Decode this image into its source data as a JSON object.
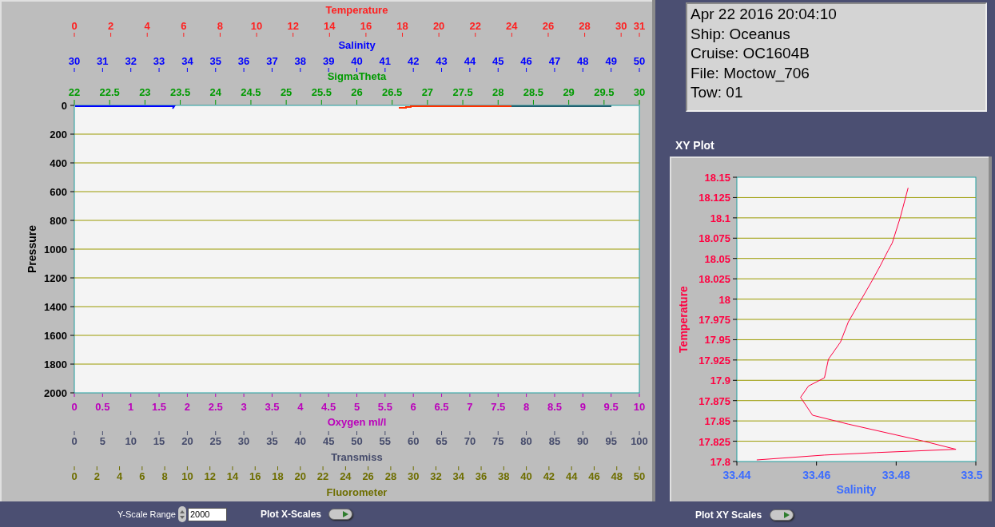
{
  "depth_plot": {
    "top_axes": [
      {
        "title": "Temperature",
        "color": "#ff2020",
        "ticks": [
          "0",
          "2",
          "4",
          "6",
          "8",
          "10",
          "12",
          "14",
          "16",
          "18",
          "20",
          "22",
          "24",
          "26",
          "28",
          "30",
          "31"
        ]
      },
      {
        "title": "Salinity",
        "color": "#0000ff",
        "ticks": [
          "30",
          "31",
          "32",
          "33",
          "34",
          "35",
          "36",
          "37",
          "38",
          "39",
          "40",
          "41",
          "42",
          "43",
          "44",
          "45",
          "46",
          "47",
          "48",
          "49",
          "50"
        ]
      },
      {
        "title": "SigmaTheta",
        "color": "#009a00",
        "ticks": [
          "22",
          "22.5",
          "23",
          "23.5",
          "24",
          "24.5",
          "25",
          "25.5",
          "26",
          "26.5",
          "27",
          "27.5",
          "28",
          "28.5",
          "29",
          "29.5",
          "30"
        ]
      }
    ],
    "bottom_axes": [
      {
        "title": "Oxygen ml/l",
        "color": "#bb00bb",
        "ticks": [
          "0",
          "0.5",
          "1",
          "1.5",
          "2",
          "2.5",
          "3",
          "3.5",
          "4",
          "4.5",
          "5",
          "5.5",
          "6",
          "6.5",
          "7",
          "7.5",
          "8",
          "8.5",
          "9",
          "9.5",
          "10"
        ]
      },
      {
        "title": "Transmiss",
        "color": "#454b6b",
        "ticks": [
          "0",
          "5",
          "10",
          "15",
          "20",
          "25",
          "30",
          "35",
          "40",
          "45",
          "50",
          "55",
          "60",
          "65",
          "70",
          "75",
          "80",
          "85",
          "90",
          "95",
          "100"
        ]
      },
      {
        "title": "Fluorometer",
        "color": "#6e6e00",
        "ticks": [
          "0",
          "2",
          "4",
          "6",
          "8",
          "10",
          "12",
          "14",
          "16",
          "18",
          "20",
          "22",
          "24",
          "26",
          "28",
          "30",
          "32",
          "34",
          "36",
          "38",
          "40",
          "42",
          "44",
          "46",
          "48",
          "50"
        ]
      }
    ],
    "y_axis": {
      "title": "Pressure",
      "ticks": [
        "0",
        "200",
        "400",
        "600",
        "800",
        "1000",
        "1200",
        "1400",
        "1600",
        "1800",
        "2000"
      ]
    }
  },
  "controls": {
    "y_scale_range": {
      "label": "Y-Scale Range",
      "value": "2000"
    },
    "plot_x_scales": {
      "label": "Plot X-Scales"
    },
    "plot_xy_scales": {
      "label": "Plot XY Scales"
    }
  },
  "info": {
    "lines": [
      "Apr 22 2016 20:04:10",
      "Ship: Oceanus",
      "Cruise: OC1604B",
      "File: Moctow_706",
      "Tow: 01"
    ]
  },
  "xy_plot": {
    "title": "XY Plot",
    "chart_data": {
      "type": "line",
      "xlabel": "Salinity",
      "ylabel": "Temperature",
      "grid": true,
      "xlim": [
        33.44,
        33.5
      ],
      "ylim": [
        17.8,
        18.15
      ],
      "xticks": [
        33.44,
        33.46,
        33.48,
        33.5
      ],
      "yticks": [
        17.8,
        17.825,
        17.85,
        17.875,
        17.9,
        17.925,
        17.95,
        17.975,
        18,
        18.025,
        18.05,
        18.075,
        18.1,
        18.125,
        18.15
      ],
      "series": [
        {
          "color": "#ff0040",
          "x": [
            33.483,
            33.481,
            33.479,
            33.478,
            33.476,
            33.474,
            33.468,
            33.466,
            33.463,
            33.462,
            33.458,
            33.456,
            33.459,
            33.468,
            33.487,
            33.495,
            33.475,
            33.462,
            33.445
          ],
          "values": [
            18.137,
            18.1,
            18.069,
            18.06,
            18.041,
            18.023,
            17.972,
            17.947,
            17.926,
            17.903,
            17.893,
            17.879,
            17.857,
            17.846,
            17.825,
            17.815,
            17.811,
            17.808,
            17.802
          ]
        }
      ]
    }
  }
}
